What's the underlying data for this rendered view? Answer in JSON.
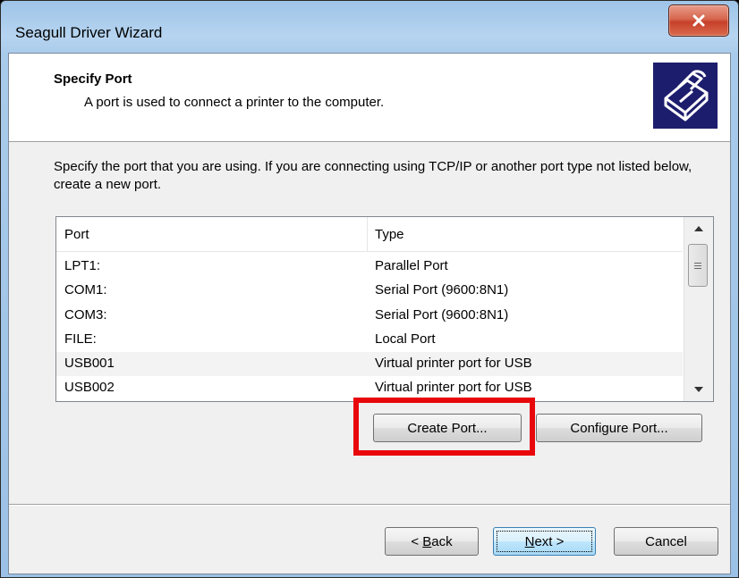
{
  "window": {
    "title": "Seagull Driver Wizard"
  },
  "header": {
    "title": "Specify Port",
    "subtitle": "A port is used to connect a printer to the computer."
  },
  "description": "Specify the port that you are using.  If you are connecting using TCP/IP or another port type not listed below, create a new port.",
  "ports_list": {
    "columns": [
      "Port",
      "Type"
    ],
    "rows": [
      {
        "port": "LPT1:",
        "type": "Parallel Port"
      },
      {
        "port": "COM1:",
        "type": "Serial Port (9600:8N1)"
      },
      {
        "port": "COM3:",
        "type": "Serial Port (9600:8N1)"
      },
      {
        "port": "FILE:",
        "type": "Local Port"
      },
      {
        "port": "USB001",
        "type": "Virtual printer port for USB"
      },
      {
        "port": "USB002",
        "type": "Virtual printer port for USB"
      }
    ]
  },
  "buttons": {
    "create_port": "Create Port...",
    "configure_port": "Configure Port...",
    "back_accel": "B",
    "back_rest": "ack",
    "back_prefix": "< ",
    "next_accel": "N",
    "next_rest": "ext >",
    "cancel": "Cancel"
  },
  "colors": {
    "highlight": "#e8070b",
    "title_bar": "#a9cbeb",
    "icon_background": "#1d1d6e"
  },
  "icons": {
    "close": "close-icon",
    "printer": "printer-icon",
    "scroll_up": "scroll-up-arrow-icon",
    "scroll_down": "scroll-down-arrow-icon"
  }
}
